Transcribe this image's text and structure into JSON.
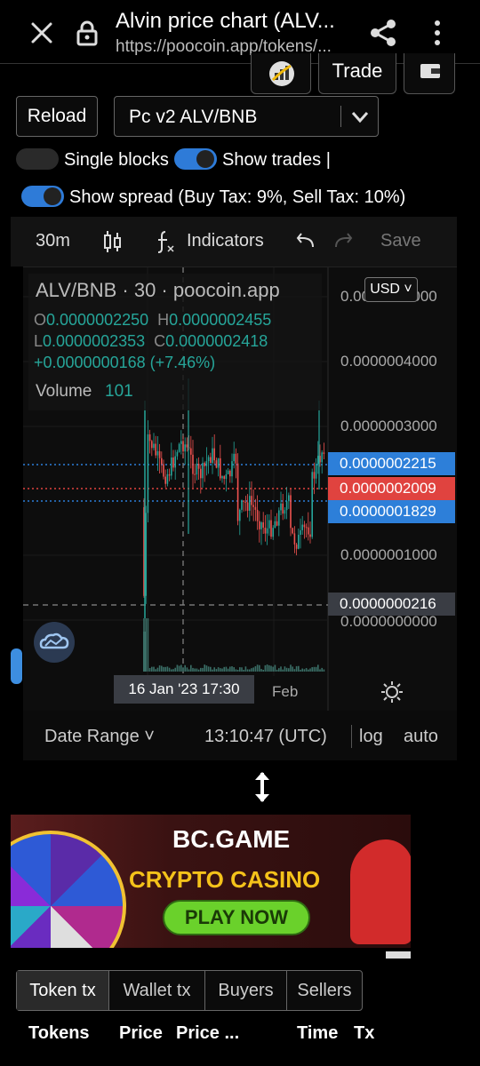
{
  "browser": {
    "title": "Alvin price chart (ALV...",
    "url": "https://poocoin.app/tokens/...",
    "icons": [
      "close-icon",
      "lock-icon",
      "share-icon",
      "more-vert-icon"
    ]
  },
  "actions": {
    "trade_label": "Trade",
    "reload_label": "Reload",
    "pair_value": "Pc v2 ALV/BNB"
  },
  "toggles": {
    "single_blocks": {
      "label": "Single blocks",
      "on": false
    },
    "show_trades": {
      "label": "Show trades |",
      "on": true
    },
    "show_spread": {
      "label": "Show spread (Buy Tax: 9%, Sell Tax: 10%)",
      "on": true
    }
  },
  "chart_toolbar": {
    "interval": "30m",
    "indicators": "Indicators",
    "save": "Save"
  },
  "chart": {
    "legend_title": "ALV/BNB · 30 · poocoin.app",
    "o_key": "O",
    "o_val": "0.0000002250",
    "h_key": "H",
    "h_val": "0.0000002455",
    "l_key": "L",
    "l_val": "0.0000002353",
    "c_key": "C",
    "c_val": "0.0000002418",
    "change": "+0.0000000168 (+7.46%)",
    "volume_label": "Volume",
    "volume_value": "101",
    "currency": "USD",
    "axis_top": "0.0000005000",
    "axis_4": "0.0000004000",
    "axis_3": "0.0000003000",
    "axis_1": "0.0000001000",
    "axis_0": "0.0000000000",
    "tag_upper": "0.0000002215",
    "tag_current": "0.0000002009",
    "tag_lower": "0.0000001829",
    "tag_cursor": "0.0000000216",
    "date_crosshair": "16 Jan '23   17:30",
    "x_feb": "Feb",
    "colors": {
      "up": "#26a69a",
      "down": "#ef5350",
      "accent": "#2d7fd9"
    }
  },
  "chart_footer": {
    "date_range": "Date Range",
    "time": "13:10:47 (UTC)",
    "log": "log",
    "auto": "auto"
  },
  "ad": {
    "brand": "BC.GAME",
    "headline": "CRYPTO CASINO",
    "cta": "PLAY NOW"
  },
  "tabs": [
    "Token tx",
    "Wallet tx",
    "Buyers",
    "Sellers"
  ],
  "table_headers": [
    "Tokens",
    "Price",
    "Price ...",
    "Time",
    "Tx"
  ]
}
